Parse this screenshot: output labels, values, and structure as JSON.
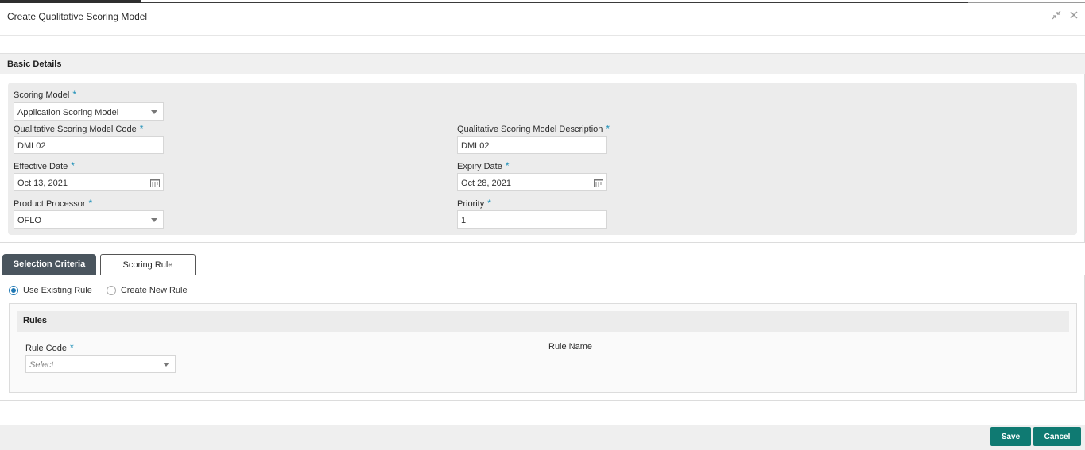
{
  "window": {
    "title": "Create Qualitative Scoring Model",
    "icons": [
      "collapse-icon",
      "close-icon"
    ]
  },
  "basic_details": {
    "header": "Basic Details",
    "scoring_model": {
      "label": "Scoring Model",
      "value": "Application Scoring Model"
    },
    "code": {
      "label": "Qualitative Scoring Model Code",
      "value": "DML02"
    },
    "description": {
      "label": "Qualitative Scoring Model Description",
      "value": "DML02"
    },
    "effective_date": {
      "label": "Effective Date",
      "value": "Oct 13, 2021"
    },
    "expiry_date": {
      "label": "Expiry Date",
      "value": "Oct 28, 2021"
    },
    "product_processor": {
      "label": "Product Processor",
      "value": "OFLO"
    },
    "priority": {
      "label": "Priority",
      "value": "1"
    },
    "required_mark": "*"
  },
  "tabs": [
    {
      "label": "Selection Criteria",
      "active": true
    },
    {
      "label": "Scoring Rule",
      "active": false
    }
  ],
  "selection": {
    "options": [
      {
        "label": "Use Existing Rule",
        "selected": true
      },
      {
        "label": "Create New Rule",
        "selected": false
      }
    ],
    "rules": {
      "header": "Rules",
      "rule_code": {
        "label": "Rule Code",
        "placeholder": "Select"
      },
      "rule_name": {
        "label": "Rule Name"
      }
    }
  },
  "footer": {
    "save": "Save",
    "cancel": "Cancel"
  },
  "colors": {
    "accent": "#0f7a72",
    "required": "#1e90b8",
    "active_tab": "#4a555e"
  }
}
